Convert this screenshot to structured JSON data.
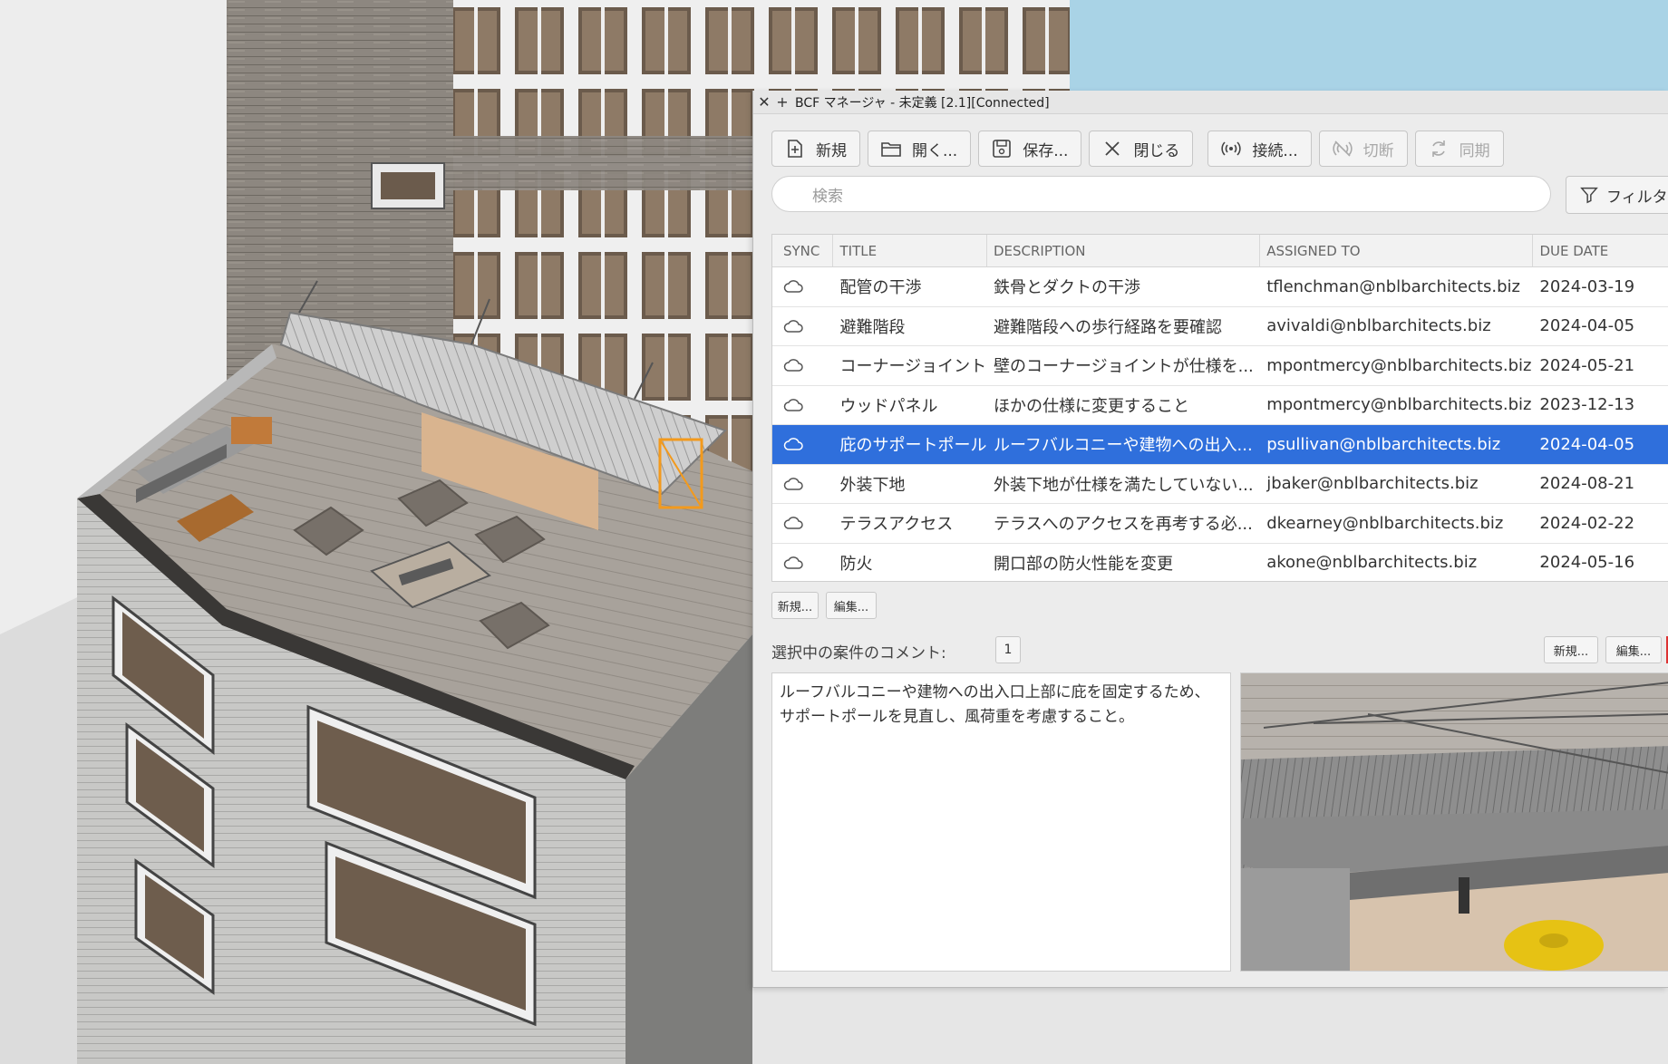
{
  "window": {
    "close_glyph": "✕",
    "add_glyph": "+",
    "title": "BCF マネージャ - 未定義 [2.1][Connected]"
  },
  "toolbar": {
    "new_label": "新規",
    "open_label": "開く...",
    "save_label": "保存...",
    "close_label": "閉じる",
    "connect_label": "接続...",
    "disconnect_label": "切断",
    "sync_label": "同期"
  },
  "search": {
    "placeholder": "検索"
  },
  "filter": {
    "label": "フィルタ..."
  },
  "table": {
    "headers": {
      "sync": "SYNC",
      "title": "TITLE",
      "description": "DESCRIPTION",
      "assigned": "ASSIGNED TO",
      "due": "DUE DATE"
    },
    "rows": [
      {
        "title": "配管の干渉",
        "description": "鉄骨とダクトの干渉",
        "assigned": "tflenchman@nblbarchitects.biz",
        "due": "2024-03-19"
      },
      {
        "title": "避難階段",
        "description": "避難階段への歩行経路を要確認",
        "assigned": "avivaldi@nblbarchitects.biz",
        "due": "2024-04-05"
      },
      {
        "title": "コーナージョイント",
        "description": "壁のコーナージョイントが仕様を...",
        "assigned": "mpontmercy@nblbarchitects.biz",
        "due": "2024-05-21"
      },
      {
        "title": "ウッドパネル",
        "description": "ほかの仕様に変更すること",
        "assigned": "mpontmercy@nblbarchitects.biz",
        "due": "2023-12-13"
      },
      {
        "title": "庇のサポートポール",
        "description": "ルーフバルコニーや建物への出入...",
        "assigned": "psullivan@nblbarchitects.biz",
        "due": "2024-04-05"
      },
      {
        "title": "外装下地",
        "description": "外装下地が仕様を満たしていない...",
        "assigned": "jbaker@nblbarchitects.biz",
        "due": "2024-08-21"
      },
      {
        "title": "テラスアクセス",
        "description": "テラスへのアクセスを再考する必...",
        "assigned": "dkearney@nblbarchitects.biz",
        "due": "2024-02-22"
      },
      {
        "title": "防火",
        "description": "開口部の防火性能を変更",
        "assigned": "akone@nblbarchitects.biz",
        "due": "2024-05-16"
      }
    ],
    "selected_index": 4
  },
  "issue_actions": {
    "new_label": "新規...",
    "edit_label": "編集..."
  },
  "comments": {
    "label": "選択中の案件のコメント:",
    "count": "1",
    "new_label": "新規...",
    "edit_label": "編集...",
    "text_line1": "ルーフバルコニーや建物への出入口上部に庇を固定するため、",
    "text_line2": "サポートポールを見直し、風荷重を考慮すること。"
  },
  "colors": {
    "selection": "#2f6fdc",
    "sky": "#a9d3e6",
    "highlight": "#f39a1c"
  }
}
